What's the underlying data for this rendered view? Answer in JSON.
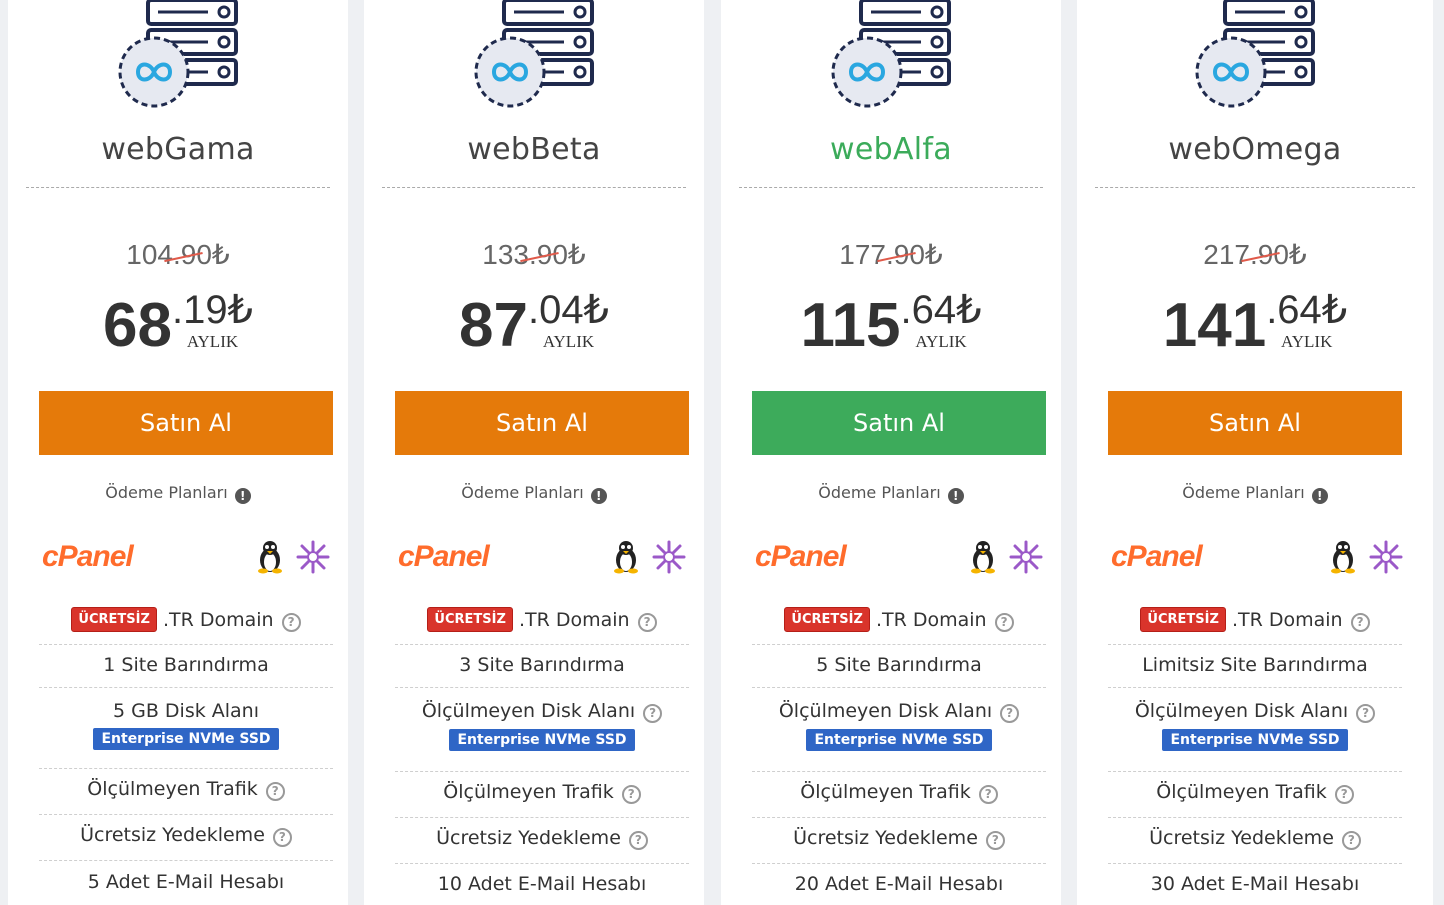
{
  "plans": [
    {
      "name": "webGama",
      "old_price": "104.90₺",
      "price_int": "68",
      "price_dec": ".19₺",
      "period": "AYLIK",
      "buy_label": "Satın Al",
      "pay_plans": "Ödeme Planları",
      "panel": "cPanel",
      "domain_badge": "ÜCRETSİZ",
      "domain_text": ".TR Domain",
      "sites": "1 Site Barındırma",
      "disk": "5 GB Disk Alanı",
      "nvme": "Enterprise NVMe SSD",
      "traffic": "Ölçülmeyen Trafik",
      "backup": "Ücretsiz Yedekleme",
      "email": "5 Adet E-Mail Hesabı"
    },
    {
      "name": "webBeta",
      "old_price": "133.90₺",
      "price_int": "87",
      "price_dec": ".04₺",
      "period": "AYLIK",
      "buy_label": "Satın Al",
      "pay_plans": "Ödeme Planları",
      "panel": "cPanel",
      "domain_badge": "ÜCRETSİZ",
      "domain_text": ".TR Domain",
      "sites": "3 Site Barındırma",
      "disk": "Ölçülmeyen Disk Alanı",
      "nvme": "Enterprise NVMe SSD",
      "traffic": "Ölçülmeyen Trafik",
      "backup": "Ücretsiz Yedekleme",
      "email": "10 Adet E-Mail Hesabı"
    },
    {
      "name": "webAlfa",
      "old_price": "177.90₺",
      "price_int": "115",
      "price_dec": ".64₺",
      "period": "AYLIK",
      "buy_label": "Satın Al",
      "pay_plans": "Ödeme Planları",
      "panel": "cPanel",
      "domain_badge": "ÜCRETSİZ",
      "domain_text": ".TR Domain",
      "sites": "5 Site Barındırma",
      "disk": "Ölçülmeyen Disk Alanı",
      "nvme": "Enterprise NVMe SSD",
      "traffic": "Ölçülmeyen Trafik",
      "backup": "Ücretsiz Yedekleme",
      "email": "20 Adet E-Mail Hesabı"
    },
    {
      "name": "webOmega",
      "old_price": "217.90₺",
      "price_int": "141",
      "price_dec": ".64₺",
      "period": "AYLIK",
      "buy_label": "Satın Al",
      "pay_plans": "Ödeme Planları",
      "panel": "cPanel",
      "domain_badge": "ÜCRETSİZ",
      "domain_text": ".TR Domain",
      "sites": "Limitsiz Site Barındırma",
      "disk": "Ölçülmeyen Disk Alanı",
      "nvme": "Enterprise NVMe SSD",
      "traffic": "Ölçülmeyen Trafik",
      "backup": "Ücretsiz Yedekleme",
      "email": "30 Adet E-Mail Hesabı"
    }
  ],
  "colors": {
    "orange_button": "#e57a0a",
    "green_button": "#3dab5b",
    "featured_name": "#3bab5a",
    "free_badge": "#d9342b",
    "nvme_badge": "#2f66c6"
  },
  "icons": {
    "server": "server-infinity-icon",
    "info": "info-icon",
    "linux": "linux-tux-icon",
    "snowflake": "snowflake-icon",
    "help": "question-circle-icon"
  }
}
